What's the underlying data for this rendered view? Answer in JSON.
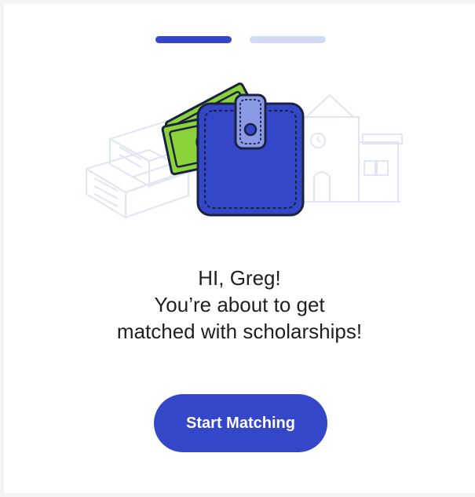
{
  "progress": {
    "total_steps": 2,
    "current_step": 1,
    "colors": {
      "active": "#3347c8",
      "inactive": "#d4d9f3"
    }
  },
  "illustration": {
    "icons": [
      "wallet-icon",
      "money-icon",
      "buildings-background"
    ]
  },
  "greeting": {
    "line1": "HI, Greg!",
    "line2": "You’re about to get",
    "line3": "matched with scholarships!"
  },
  "actions": {
    "start_label": "Start Matching",
    "button_color": "#3347c8"
  }
}
